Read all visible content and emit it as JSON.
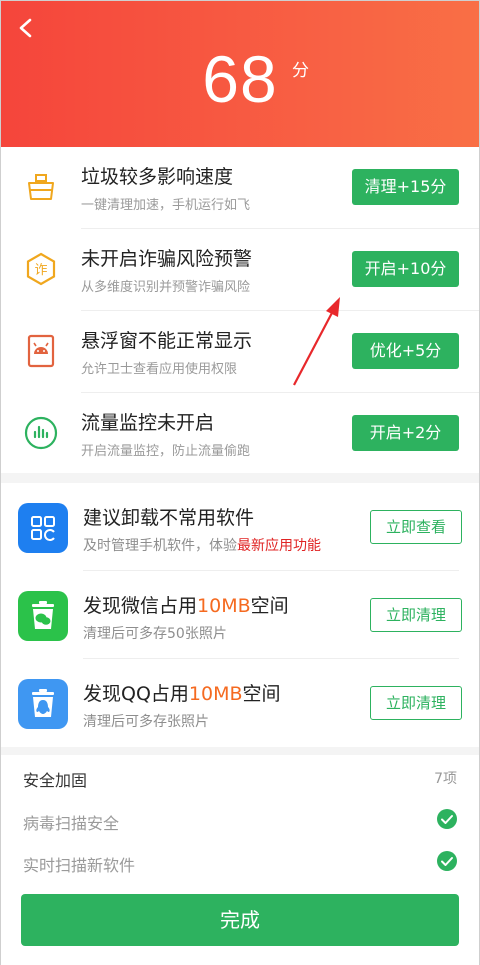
{
  "header": {
    "score": "68",
    "score_unit": "分"
  },
  "issues": [
    {
      "title": "垃圾较多影响速度",
      "subtitle": "一键清理加速，手机运行如飞",
      "button": "清理+15分",
      "icon": "broom-icon"
    },
    {
      "title": "未开启诈骗风险预警",
      "subtitle": "从多维度识别并预警诈骗风险",
      "button": "开启+10分",
      "icon": "fraud-hexagon-icon"
    },
    {
      "title": "悬浮窗不能正常显示",
      "subtitle": "允许卫士查看应用使用权限",
      "button": "优化+5分",
      "icon": "android-window-icon"
    },
    {
      "title": "流量监控未开启",
      "subtitle": "开启流量监控，防止流量偷跑",
      "button": "开启+2分",
      "icon": "traffic-chart-icon"
    }
  ],
  "suggestions": [
    {
      "title": "建议卸载不常用软件",
      "subtitle_prefix": "及时管理手机软件，体验",
      "subtitle_highlight": "最新应用功能",
      "button": "立即查看",
      "icon": "app-grid-icon"
    },
    {
      "title_prefix": "发现微信占用",
      "title_highlight": "10MB",
      "title_suffix": "空间",
      "subtitle": "清理后可多存50张照片",
      "button": "立即清理",
      "icon": "wechat-trash-icon"
    },
    {
      "title_prefix": "发现QQ占用",
      "title_highlight": "10MB",
      "title_suffix": "空间",
      "subtitle": "清理后可多存张照片",
      "button": "立即清理",
      "icon": "qq-trash-icon"
    }
  ],
  "security": {
    "title": "安全加固",
    "count": "7项",
    "items": [
      {
        "label": "病毒扫描安全",
        "status_icon": "check-circle-icon"
      },
      {
        "label": "实时扫描新软件",
        "status_icon": "check-circle-icon"
      }
    ]
  },
  "done_button": "完成",
  "colors": {
    "header_start": "#f5453b",
    "header_end": "#f96f45",
    "accent_green": "#2db25f",
    "highlight_red": "#e02424",
    "highlight_orange": "#f56a20"
  }
}
